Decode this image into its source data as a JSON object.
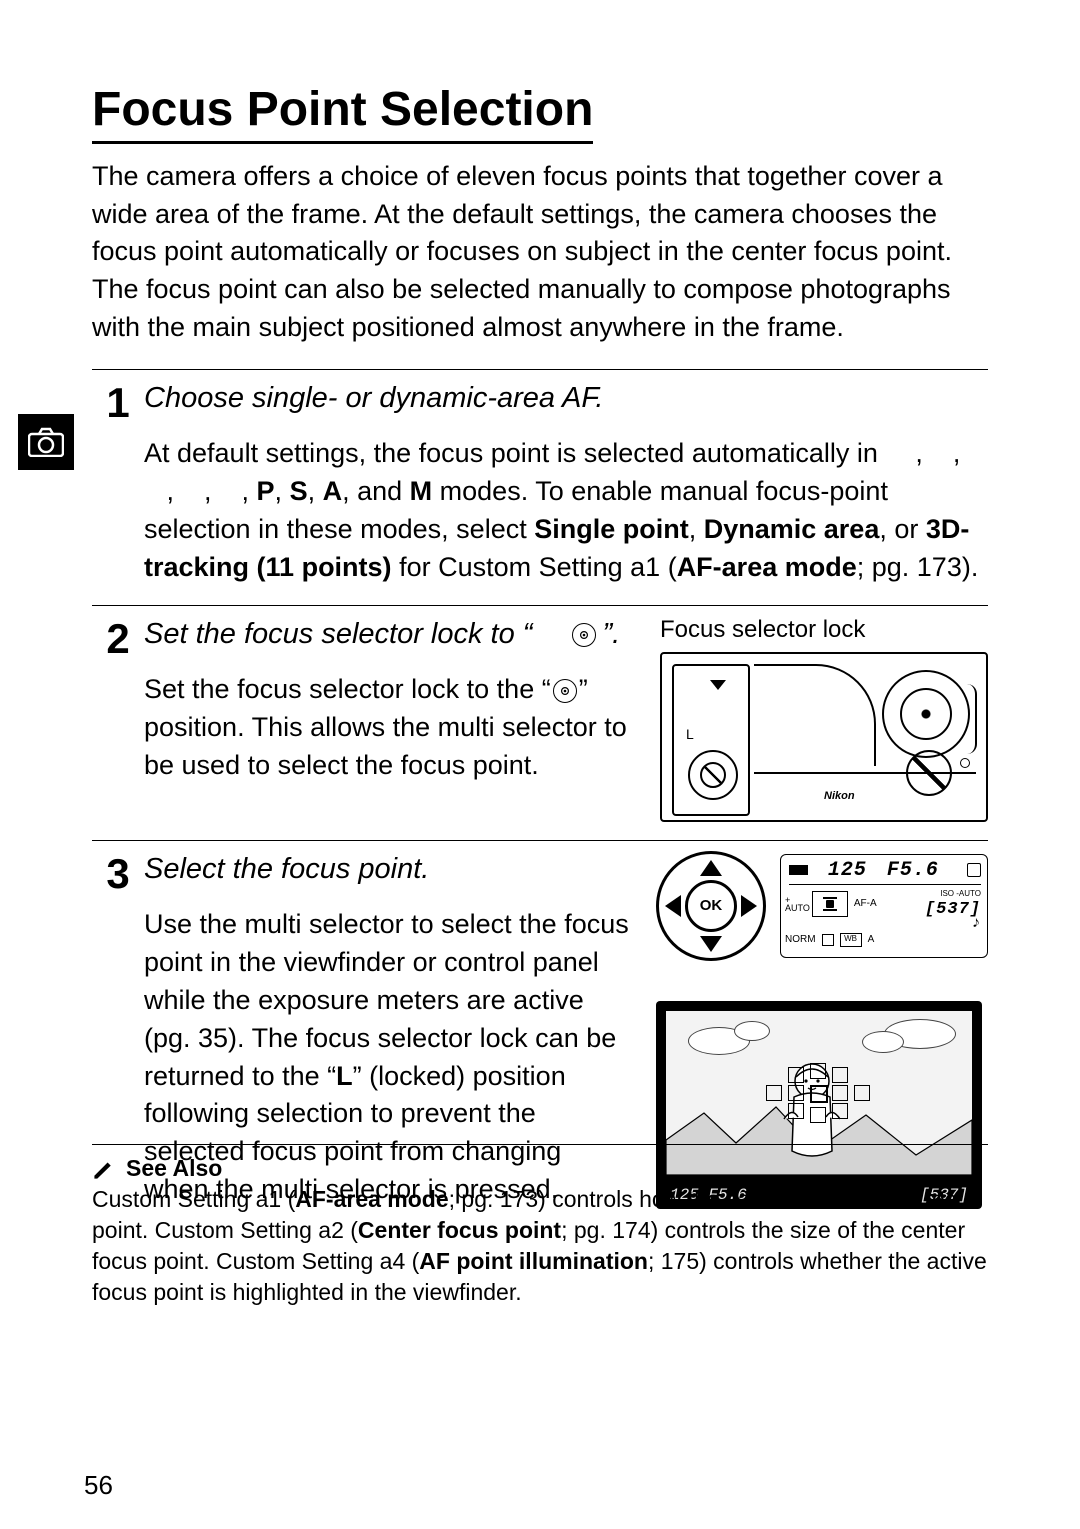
{
  "pageNumber": "56",
  "title": "Focus Point Selection",
  "intro": "The camera offers a choice of eleven focus points that together cover a wide area of the frame.  At the default settings, the camera chooses the focus point automatically or focuses on subject in the center focus point.  The focus point can also be selected manually to compose photographs with the main subject positioned almost anywhere in the frame.",
  "step1": {
    "num": "1",
    "title": "Choose single- or dynamic-area AF.",
    "text_lead": "At default settings, the focus point is selected automatically in     ,    ,    ,    ,    , ",
    "modes": {
      "p": "P",
      "s": "S",
      "a": "A",
      "m": "M",
      "sep1": ", ",
      "sep2": ", ",
      "and": ", and ",
      "tail": " modes.  To enable manual focus-point selection in these modes, select "
    },
    "bold1": "Single point",
    "comma1": ", ",
    "bold2": "Dynamic area",
    "comma2": ", or ",
    "bold3": "3D-tracking (11 points)",
    "text_tail": " for Custom Setting a1 (",
    "bold4": "AF-area mode",
    "text_tail2": "; pg. 173)."
  },
  "step2": {
    "num": "2",
    "title_lead": "Set the focus selector lock to “",
    "title_tail": "”.",
    "caption": "Focus selector lock",
    "text_lead": "Set the focus selector lock to the “",
    "text_tail": "” position.  This allows the multi selector to be used to select the focus point.",
    "illus_nikon": "Nikon",
    "illus_L": "L"
  },
  "step3": {
    "num": "3",
    "title": "Select the focus point.",
    "text_lead": "Use the multi selector to select the focus point in the viewfinder or control panel while the exposure meters are active (pg. 35).  The focus selector lock can be returned to the “",
    "lock_letter": "L",
    "text_tail": "” (locked) position following selection to prevent the selected focus point from changing when the multi selector is pressed.",
    "ok_label": "OK",
    "ctrl_panel": {
      "shutter": "125",
      "aperture": "F5.6",
      "auto_top": "+",
      "auto_bot": "AUTO",
      "af": "AF-A",
      "iso_lbl": "ISO -AUTO",
      "iso_val": "[537]",
      "note": "♪",
      "norm": "NORM",
      "wb": "WB",
      "a": "A"
    },
    "viewfinder": {
      "left": "125  F5.6",
      "right": "[537]"
    }
  },
  "seeAlso": {
    "title": "See Also",
    "l1a": "Custom Setting a1 (",
    "l1b": "AF-area mode",
    "l1c": "; pg. 173) controls how the camera selects the focus point.  Custom Setting a2 (",
    "l2b": "Center focus point",
    "l2c": "; pg. 174) controls the size of the center focus point.  Custom Setting a4 (",
    "l3b": "AF point illumination",
    "l3c": "; 175) controls whether the active focus point is highlighted in the viewfinder."
  }
}
